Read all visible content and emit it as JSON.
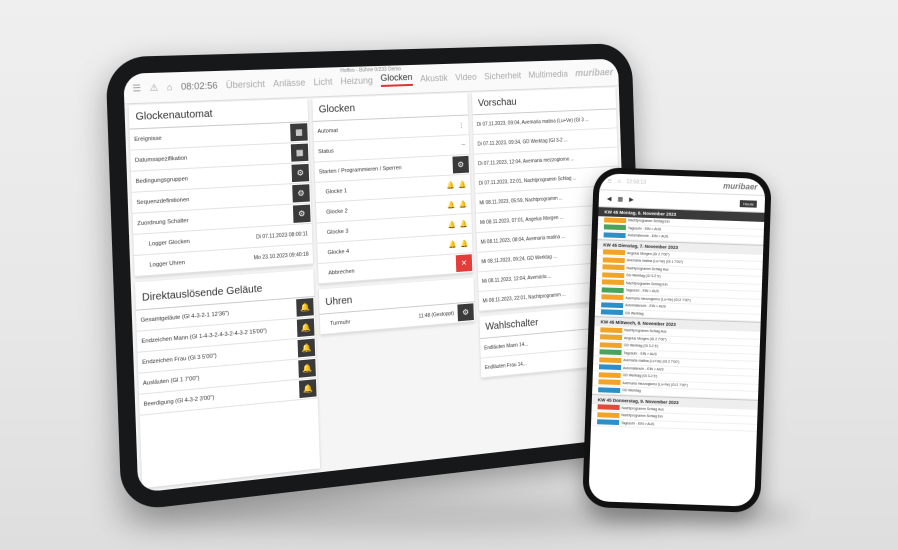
{
  "tablet": {
    "clock": "08:02:56",
    "nav": [
      "Übersicht",
      "Anlässe",
      "Licht",
      "Heizung",
      "Glocken",
      "Akustik",
      "Video",
      "Sicherheit",
      "Multimedia"
    ],
    "active_nav": "Glocken",
    "location": "Hoffeo - Bühne 0/233 Demo",
    "brand": "muribaer",
    "glockenautomat": {
      "title": "Glockenautomat",
      "items": [
        "Ereignisse",
        "Datumsspezifikation",
        "Bedingungsgruppen",
        "Sequenzdefinitionen",
        "Zuordnung Schalter"
      ],
      "logger": [
        {
          "label": "Logger Glocken",
          "value": "Di 07.11.2023 08:00:11"
        },
        {
          "label": "Logger Uhren",
          "value": "Mo 23.10.2023 09:40:18"
        }
      ]
    },
    "direkt": {
      "title": "Direktauslösende Geläute",
      "items": [
        "Gesamtgeläute (Gl 4-3-2-1 12'36\")",
        "Endzeichen Mann (Gl 1-4-3-2-4-3-2-4-3-2 15'00\")",
        "Endzeichen Frau (Gl 3 5'00\")",
        "Ausläuten (Gl 1 7'00\")",
        "Beerdigung (Gl 4-3-2 3'00\")"
      ]
    },
    "glocken": {
      "title": "Glocken",
      "automat": "Automat",
      "status": "Status",
      "starten": "Starten / Programmieren / Sperren",
      "bells": [
        "Glocke 1",
        "Glocke 2",
        "Glocke 3",
        "Glocke 4"
      ],
      "abbrechen": "Abbrechen"
    },
    "uhren": {
      "title": "Uhren",
      "turmuhr": "Turmuhr",
      "turmuhr_value": "11:48 (Gestoppt)"
    },
    "vorschau": {
      "title": "Vorschau",
      "items": [
        "Di 07.11.2023, 09:04, Avemaria matina (Lu+Ve) (Gl 3 ...",
        "Di 07.11.2023, 09:34, GD Werktag (Gl 3-2 ...",
        "Di 07.11.2023, 12:04, Avemaria mezzogiorno ...",
        "Di 07.11.2023, 22:01, Nachtprogramm Schlag ...",
        "Mi 08.11.2023, 05:59, Nachtprogramm ...",
        "Mi 08.11.2023, 07:01, Angelus Morgen ...",
        "Mi 08.11.2023, 08:04, Avemaria matina ...",
        "Mi 08.11.2023, 09:24, GD Werktag ...",
        "Mi 08.11.2023, 12:04, Avemaria ...",
        "Mi 08.11.2023, 22:01, Nachtprogramm ..."
      ]
    },
    "wahlschalter": {
      "title": "Wahlschalter",
      "items": [
        "Endläuten Mann 14...",
        "Endläuten Frau 14..."
      ]
    }
  },
  "phone": {
    "clock": "12:58:13",
    "brand": "muribaer",
    "heute": "Heute",
    "days": [
      {
        "title": "KW 45  Montag, 6. November 2023",
        "dark": true,
        "events": [
          [
            "o",
            "Nachtprogramm Schlag Ein"
          ],
          [
            "g",
            "Tagesuhr - EIN > AUS"
          ],
          [
            "b",
            "Automatenuhr - EIN > AUS"
          ]
        ]
      },
      {
        "title": "KW 45  Dienstag, 7. November 2023",
        "dark": false,
        "events": [
          [
            "o",
            "Angelus Morgen (Gl 2 7'00\")"
          ],
          [
            "o",
            "Avemaria matina (Lu+Ve) (Gl 1 7'00\")"
          ],
          [
            "o",
            "Nachtprogramm Schlag Aus"
          ],
          [
            "o",
            "GD Werktag (Gl 3-2 5')"
          ],
          [
            "o",
            "Nachtprogramm Schlag Ein"
          ],
          [
            "g",
            "Tagesuhr - EIN > AUS"
          ],
          [
            "o",
            "Avemaria mezzogiorno (Lu+Ve) (Gl 2 7'00\")"
          ],
          [
            "b",
            "Automatenuhr - EIN > AUS"
          ],
          [
            "b",
            "GD Werktag"
          ]
        ]
      },
      {
        "title": "KW 45  Mittwoch, 8. November 2023",
        "dark": false,
        "events": [
          [
            "o",
            "Nachtprogramm Schlag Aus"
          ],
          [
            "o",
            "Angelus Morgen (Gl 2 7'00\")"
          ],
          [
            "o",
            "GD Werktag (Gl 3-2 5')"
          ],
          [
            "g",
            "Tagesuhr - EIN > AUS"
          ],
          [
            "o",
            "Avemaria matina (Lu+Ve) (Gl 2 7'00\")"
          ],
          [
            "b",
            "Automatenuhr - EIN > AUS"
          ],
          [
            "o",
            "GD Werktag (Gl 3-2 5')"
          ],
          [
            "o",
            "Avemaria mezzogiorno (Lu+Ve) (Gl 2 7'00\")"
          ],
          [
            "b",
            "GD Werktag"
          ]
        ]
      },
      {
        "title": "KW 45  Donnerstag, 9. November 2023",
        "dark": false,
        "events": [
          [
            "r",
            "Nachtprogramm Schlag Aus"
          ],
          [
            "o",
            "Nachtprogramm Schlag Ein"
          ],
          [
            "b",
            "Tagesuhr - EIN > AUS"
          ]
        ]
      }
    ]
  }
}
